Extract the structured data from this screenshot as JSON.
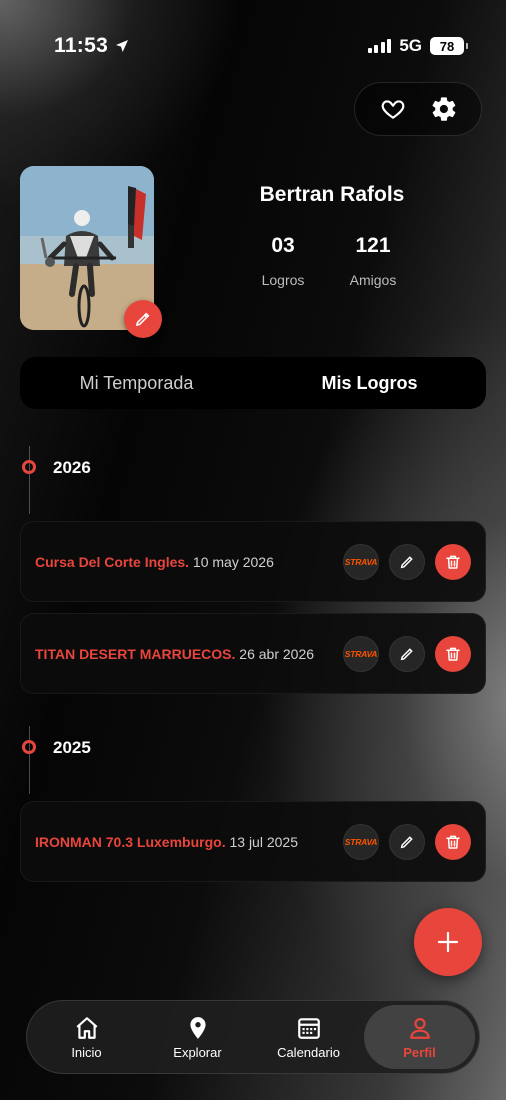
{
  "status_bar": {
    "time": "11:53",
    "network": "5G",
    "battery": "78"
  },
  "top_actions": {
    "favorite_icon": "heart-icon",
    "settings_icon": "gear-icon"
  },
  "profile": {
    "name": "Bertran Rafols",
    "stats": [
      {
        "value": "03",
        "label": "Logros"
      },
      {
        "value": "121",
        "label": "Amigos"
      }
    ]
  },
  "tabs": [
    {
      "label": "Mi Temporada",
      "active": false
    },
    {
      "label": "Mis Logros",
      "active": true
    }
  ],
  "timeline": [
    {
      "year": "2026",
      "items": [
        {
          "title": "Cursa Del Corte Ingles.",
          "date": " 10 may 2026",
          "badge": "STRAVA"
        },
        {
          "title": "TITAN DESERT MARRUECOS.",
          "date": " 26 abr 2026",
          "badge": "STRAVA"
        }
      ]
    },
    {
      "year": "2025",
      "items": [
        {
          "title": "IRONMAN 70.3 Luxemburgo.",
          "date": " 13 jul 2025",
          "badge": "STRAVA"
        }
      ]
    }
  ],
  "bottom_nav": [
    {
      "label": "Inicio",
      "icon": "home-icon",
      "active": false
    },
    {
      "label": "Explorar",
      "icon": "map-pin-icon",
      "active": false
    },
    {
      "label": "Calendario",
      "icon": "calendar-icon",
      "active": false
    },
    {
      "label": "Perfil",
      "icon": "user-icon",
      "active": true
    }
  ],
  "colors": {
    "accent": "#e8453c",
    "strava": "#fc5200"
  }
}
